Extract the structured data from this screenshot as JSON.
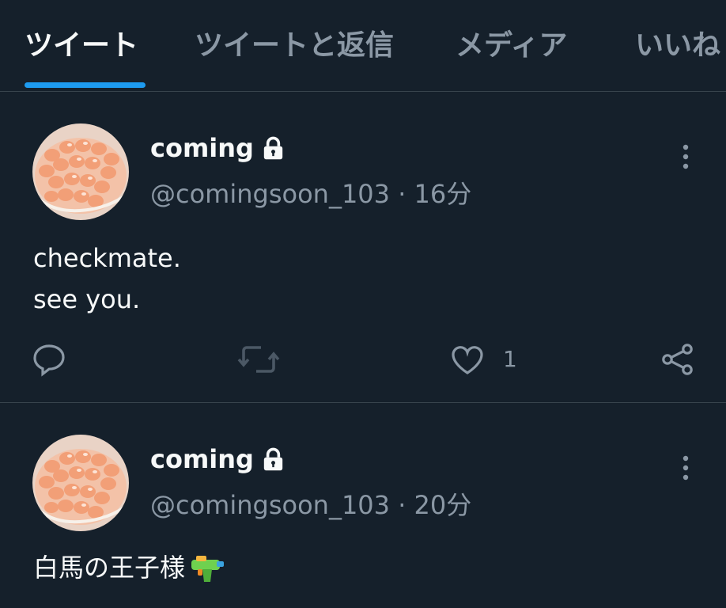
{
  "tabs": [
    {
      "label": "ツイート",
      "active": true
    },
    {
      "label": "ツイートと返信",
      "active": false
    },
    {
      "label": "メディア",
      "active": false
    },
    {
      "label": "いいね",
      "active": false
    }
  ],
  "colors": {
    "background": "#15202b",
    "accent": "#1d9bf0",
    "secondary_text": "#8b98a5",
    "divider": "#38444d"
  },
  "tweets": [
    {
      "name": "coming",
      "handle": "@comingsoon_103 · 16分",
      "lines": [
        "checkmate.",
        "see you."
      ],
      "like_count": "1",
      "icons": [
        "lock-icon",
        "more-icon",
        "reply-icon",
        "retweet-icon",
        "like-icon",
        "share-icon"
      ]
    },
    {
      "name": "coming",
      "handle": "@comingsoon_103 · 20分",
      "lines": [
        "白馬の王子様"
      ],
      "emoji": "water-pistol-emoji"
    }
  ]
}
